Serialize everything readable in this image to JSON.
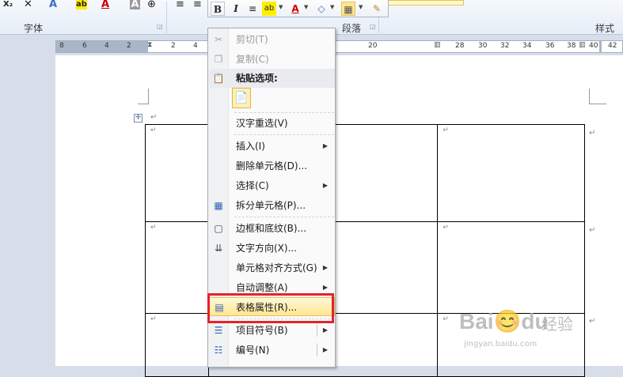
{
  "ribbon": {
    "font_group_label": "字体",
    "paragraph_group_label": "段落",
    "styles_group_label": "样式",
    "subscript_label": "X₂",
    "clear_label": "✕",
    "char_shading_label": "A",
    "highlight_label": "ab",
    "font_color_label": "A"
  },
  "mini_toolbar": {
    "bold": "B",
    "italic": "I",
    "center": "≡",
    "highlight": "ab",
    "font_color": "A",
    "fill": "◇",
    "borders": "▦",
    "format_painter": "✎"
  },
  "ruler": {
    "left_numbers": [
      "8",
      "6",
      "4",
      "2",
      "2",
      "4"
    ],
    "right_numbers": [
      "28",
      "30",
      "32",
      "34",
      "36",
      "38",
      "40",
      "42"
    ],
    "mid_numbers": [
      "20"
    ]
  },
  "context_menu": {
    "items": [
      {
        "label": "剪切(T)",
        "icon": "scissors-icon",
        "glyph": "✂",
        "disabled": true
      },
      {
        "label": "复制(C)",
        "icon": "copy-icon",
        "glyph": "❐",
        "disabled": true
      },
      {
        "label": "粘贴选项:",
        "icon": "paste-icon",
        "glyph": "📋",
        "header": true
      },
      {
        "label": "汉字重选(V)"
      },
      {
        "label": "插入(I)",
        "submenu": true
      },
      {
        "label": "删除单元格(D)..."
      },
      {
        "label": "选择(C)",
        "submenu": true
      },
      {
        "label": "拆分单元格(P)...",
        "icon": "split-cells-icon",
        "glyph": "▦"
      },
      {
        "label": "边框和底纹(B)...",
        "icon": "borders-icon",
        "glyph": "▢"
      },
      {
        "label": "文字方向(X)...",
        "icon": "text-direction-icon",
        "glyph": "⇊"
      },
      {
        "label": "单元格对齐方式(G)",
        "submenu": true
      },
      {
        "label": "自动调整(A)",
        "submenu": true
      },
      {
        "label": "表格属性(R)...",
        "icon": "table-properties-icon",
        "glyph": "▤",
        "highlight": true
      },
      {
        "label": "项目符号(B)",
        "icon": "bullets-icon",
        "glyph": "☰",
        "submenu": true,
        "split": true
      },
      {
        "label": "编号(N)",
        "icon": "numbering-icon",
        "glyph": "☷",
        "submenu": true,
        "split": true
      }
    ],
    "submenu_arrow": "▶",
    "paste_option_glyph": "📄"
  },
  "document": {
    "para_mark": "↵",
    "table_handle_glyph": "✛"
  },
  "watermark": {
    "brand": "Bai😊du",
    "chinese": "经验",
    "url": "jingyan.baidu.com"
  }
}
